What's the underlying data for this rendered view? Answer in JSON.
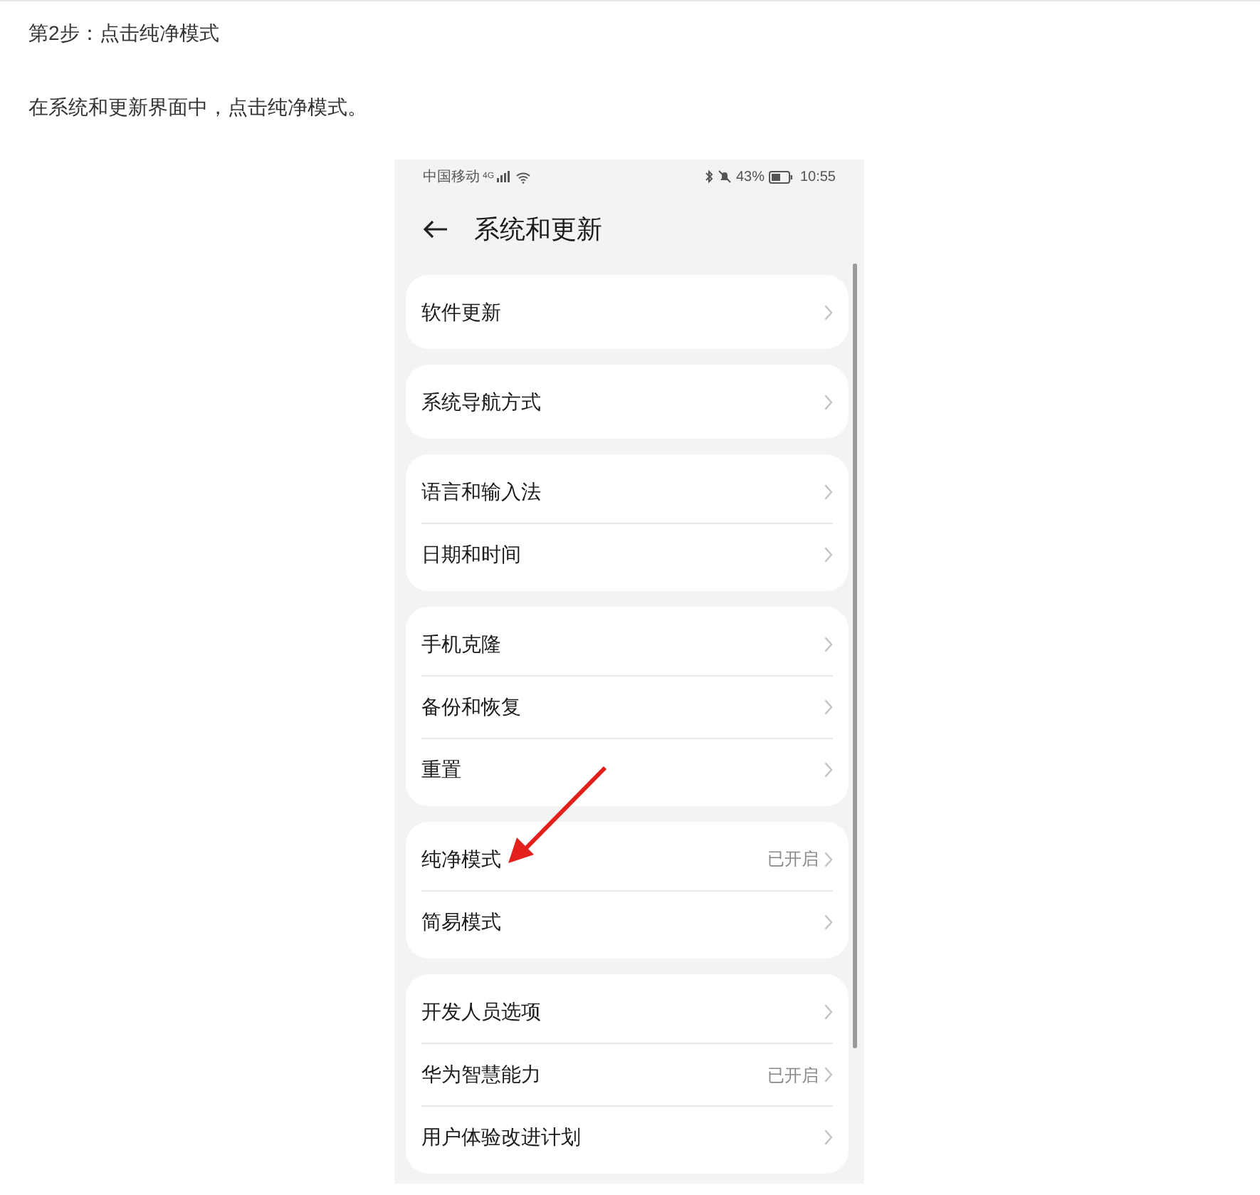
{
  "heading": "第2步：点击纯净模式",
  "instruction": "在系统和更新界面中，点击纯净模式。",
  "phone": {
    "status_bar": {
      "carrier": "中国移动",
      "network": "4G",
      "battery": "43%",
      "time": "10:55"
    },
    "title": "系统和更新",
    "groups": [
      {
        "items": [
          {
            "label": "软件更新"
          }
        ]
      },
      {
        "items": [
          {
            "label": "系统导航方式"
          }
        ]
      },
      {
        "items": [
          {
            "label": "语言和输入法"
          },
          {
            "label": "日期和时间"
          }
        ]
      },
      {
        "items": [
          {
            "label": "手机克隆"
          },
          {
            "label": "备份和恢复"
          },
          {
            "label": "重置"
          }
        ]
      },
      {
        "items": [
          {
            "label": "纯净模式",
            "value": "已开启"
          },
          {
            "label": "简易模式"
          }
        ]
      },
      {
        "items": [
          {
            "label": "开发人员选项"
          },
          {
            "label": "华为智慧能力",
            "value": "已开启"
          },
          {
            "label": "用户体验改进计划"
          }
        ]
      }
    ]
  }
}
